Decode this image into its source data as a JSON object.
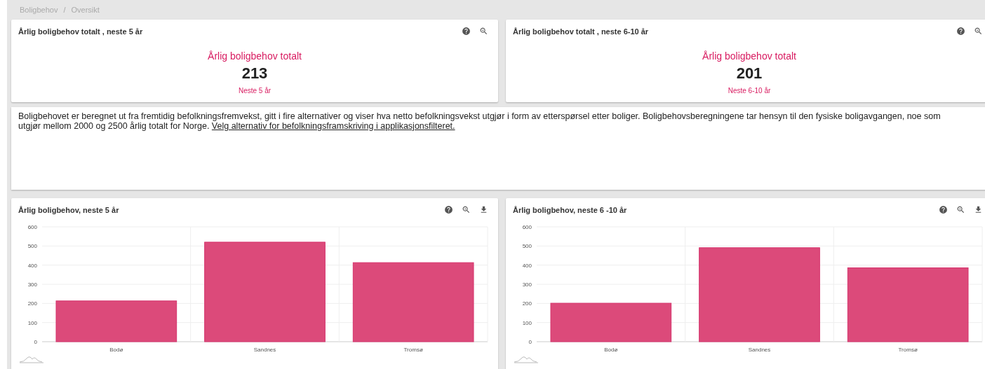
{
  "breadcrumb": {
    "items": [
      "Boligbehov",
      "Oversikt"
    ],
    "separator": "/"
  },
  "kpi_cards": [
    {
      "title": "Årlig boligbehov totalt , neste 5 år",
      "label": "Årlig boligbehov totalt",
      "value": "213",
      "period": "Neste 5 år"
    },
    {
      "title": "Årlig boligbehov totalt , neste 6-10 år",
      "label": "Årlig boligbehov totalt",
      "value": "201",
      "period": "Neste 6-10 år"
    }
  ],
  "description": {
    "text": "Boligbehovet er beregnet ut fra fremtidig befolkningsfremvekst, gitt i fire alternativer og viser hva netto befolkningsvekst utgjør i form av etterspørsel etter boliger. Boligbehovsberegningene tar hensyn til den fysiske boligavgangen, noe som utgjør mellom 2000 og 2500 årlig totalt for Norge.",
    "link": "Velg alternativ for befolkningsframskriving i applikasjonsfilteret."
  },
  "chart_cards": [
    {
      "title": "Årlig boligbehov, neste 5 år",
      "chart_data": {
        "type": "bar",
        "grid": true,
        "categories": [
          "Bodø",
          "Sandnes",
          "Tromsø"
        ],
        "values": [
          213,
          520,
          413
        ],
        "ylim": [
          0,
          600
        ],
        "yticks": [
          0,
          100,
          200,
          300,
          400,
          500,
          600
        ]
      }
    },
    {
      "title": "Årlig boligbehov, neste 6 -10 år",
      "chart_data": {
        "type": "bar",
        "grid": true,
        "categories": [
          "Bodø",
          "Sandnes",
          "Tromsø"
        ],
        "values": [
          201,
          491,
          386
        ],
        "ylim": [
          0,
          600
        ],
        "yticks": [
          0,
          100,
          200,
          300,
          400,
          500,
          600
        ]
      }
    }
  ]
}
